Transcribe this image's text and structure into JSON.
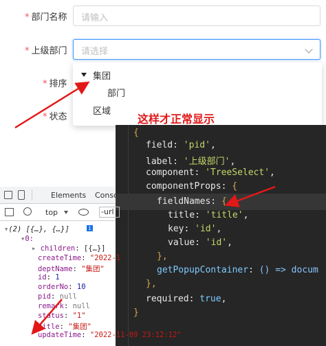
{
  "form": {
    "required_mark": "*",
    "dept_name_label": "部门名称",
    "dept_name_placeholder": "请输入",
    "parent_label": "上级部门",
    "parent_placeholder": "请选择",
    "sort_label": "排序",
    "status_label": "状态"
  },
  "tree": {
    "root": "集团",
    "child": "部门",
    "sibling": "区域"
  },
  "annotation": "这样才正常显示",
  "code": {
    "open_brace": "{",
    "field_key": "field",
    "field_val": "'pid'",
    "label_key": "label",
    "label_val": "'上级部门'",
    "component_key": "component",
    "component_val": "'TreeSelect'",
    "componentProps_key": "componentProps",
    "fieldNames_key": "fieldNames",
    "title_key": "title",
    "title_val": "'title'",
    "key_key": "key",
    "key_val": "'id'",
    "value_key": "value",
    "value_val": "'id'",
    "close_inner": "},",
    "getPopup_key": "getPopupContainer",
    "getPopup_val": "() => docum",
    "close_outer": "},",
    "required_key": "required",
    "required_val": "true",
    "close_last": "}"
  },
  "devtools": {
    "tab_elements": "Elements",
    "tab_console": "Conso",
    "context": "top",
    "filter_text": "-url",
    "summary": "(2) [{…}, {…}]",
    "index0": "0:",
    "children_key": "children",
    "children_val": "[{…}]",
    "createTime_key": "createTime",
    "createTime_val": "\"2022-1",
    "deptName_key": "deptName",
    "deptName_val": "\"集团\"",
    "id_key": "id",
    "id_val": "1",
    "orderNo_key": "orderNo",
    "orderNo_val": "10",
    "pid_key": "pid",
    "pid_val": "null",
    "remark_key": "remark",
    "remark_val": "null",
    "status_key": "status",
    "status_val": "\"1\"",
    "title_key": "title",
    "title_val": "\"集团\"",
    "updateTime_key": "updateTime",
    "updateTime_val": "\"2022-11-09 23:12:12\""
  },
  "colors": {
    "annotation_red": "#e21818",
    "required_red": "#ff4d4f",
    "focus_blue": "#4096ff",
    "editor_bg": "#262626"
  }
}
